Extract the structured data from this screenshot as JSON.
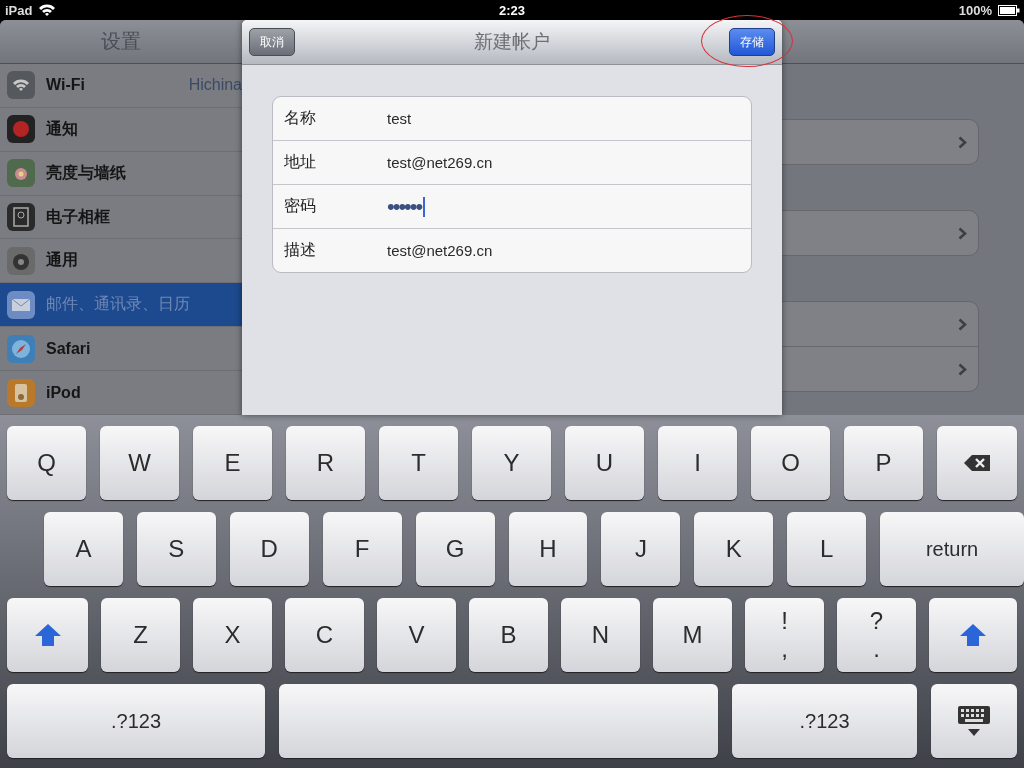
{
  "status_bar": {
    "device": "iPad",
    "time": "2:23",
    "battery": "100%"
  },
  "sidebar": {
    "title": "设置",
    "items": [
      {
        "label": "Wi-Fi",
        "value": "Hichina",
        "selected": false
      },
      {
        "label": "通知",
        "selected": false
      },
      {
        "label": "亮度与墙纸",
        "selected": false
      },
      {
        "label": "电子相框",
        "selected": false
      },
      {
        "label": "通用",
        "selected": false
      },
      {
        "label": "邮件、通讯录、日历",
        "selected": true
      },
      {
        "label": "Safari",
        "selected": false
      },
      {
        "label": "iPod",
        "selected": false
      }
    ]
  },
  "detail": {
    "groups": [
      {
        "rows": [
          {
            "disclosure": true
          }
        ]
      },
      {
        "rows": [
          {
            "disclosure": true
          }
        ]
      },
      {
        "rows": [
          {
            "disclosure": true
          },
          {
            "disclosure": true
          }
        ]
      }
    ]
  },
  "modal": {
    "title": "新建帐户",
    "cancel_button": "取消",
    "save_button": {
      "label": "存储",
      "circled": true
    },
    "fields": [
      {
        "label": "名称",
        "value": "test",
        "kind": "text",
        "focused": false
      },
      {
        "label": "地址",
        "value": "test@net269.cn",
        "kind": "text",
        "focused": false
      },
      {
        "label": "密码",
        "value": "••••••",
        "kind": "password",
        "focused": true
      },
      {
        "label": "描述",
        "value": "test@net269.cn",
        "kind": "text",
        "focused": false
      }
    ]
  },
  "keyboard": {
    "rows": [
      {
        "keys": [
          {
            "kind": "char",
            "label": "Q"
          },
          {
            "kind": "char",
            "label": "W"
          },
          {
            "kind": "char",
            "label": "E"
          },
          {
            "kind": "char",
            "label": "R"
          },
          {
            "kind": "char",
            "label": "T"
          },
          {
            "kind": "char",
            "label": "Y"
          },
          {
            "kind": "char",
            "label": "U"
          },
          {
            "kind": "char",
            "label": "I"
          },
          {
            "kind": "char",
            "label": "O"
          },
          {
            "kind": "char",
            "label": "P"
          },
          {
            "kind": "backspace"
          }
        ]
      },
      {
        "keys": [
          {
            "kind": "char",
            "label": "A"
          },
          {
            "kind": "char",
            "label": "S"
          },
          {
            "kind": "char",
            "label": "D"
          },
          {
            "kind": "char",
            "label": "F"
          },
          {
            "kind": "char",
            "label": "G"
          },
          {
            "kind": "char",
            "label": "H"
          },
          {
            "kind": "char",
            "label": "J"
          },
          {
            "kind": "char",
            "label": "K"
          },
          {
            "kind": "char",
            "label": "L"
          },
          {
            "kind": "return",
            "label": "return"
          }
        ]
      },
      {
        "keys": [
          {
            "kind": "shift"
          },
          {
            "kind": "char",
            "label": "Z"
          },
          {
            "kind": "char",
            "label": "X"
          },
          {
            "kind": "char",
            "label": "C"
          },
          {
            "kind": "char",
            "label": "V"
          },
          {
            "kind": "char",
            "label": "B"
          },
          {
            "kind": "char",
            "label": "N"
          },
          {
            "kind": "char",
            "label": "M"
          },
          {
            "kind": "dual",
            "label": "!",
            "sublabel": ","
          },
          {
            "kind": "dual",
            "label": "?",
            "sublabel": "."
          },
          {
            "kind": "shift"
          }
        ]
      },
      {
        "keys": [
          {
            "kind": "mode",
            "label": ".?123"
          },
          {
            "kind": "space"
          },
          {
            "kind": "mode",
            "label": ".?123"
          },
          {
            "kind": "hide"
          }
        ]
      }
    ]
  }
}
